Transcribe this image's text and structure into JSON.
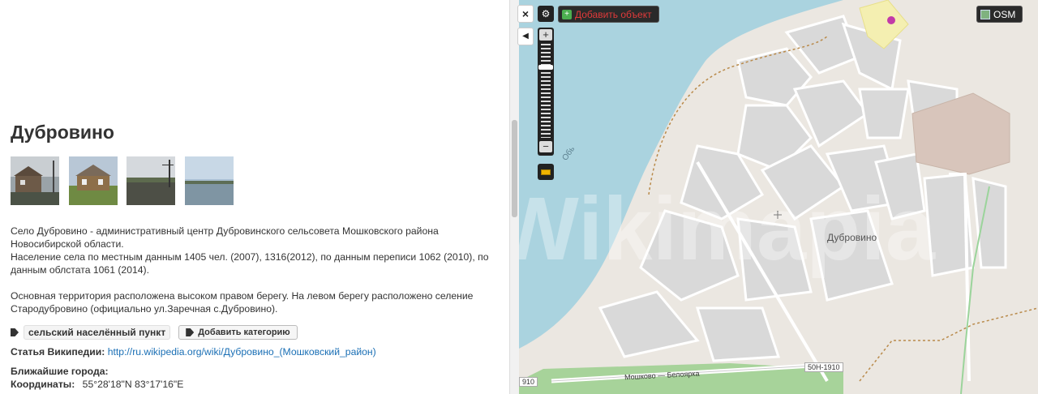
{
  "place": {
    "title": "Дубровино",
    "description": [
      "Село Дубровино - административный центр Дубровинского сельсовета Мошковского района Новосибирской области.",
      "Население села по местным данным 1405 чел. (2007), 1316(2012), по данным переписи 1062 (2010), по данным облстата 1061 (2014).",
      "",
      "Основная территория расположена высоком правом берегу. На левом берегу расположено селение Стародубровино (официально ул.Заречная с.Дубровино)."
    ],
    "tag_label": "сельский населённый пункт",
    "add_category_label": "Добавить категорию",
    "wiki_label": "Статья Википедии:",
    "wiki_url": "http://ru.wikipedia.org/wiki/Дубровино_(Мошковский_район)",
    "nearest_label": "Ближайшие города:",
    "coords_label": "Координаты:",
    "coords_value": "55°28'18\"N 83°17'16\"E"
  },
  "map": {
    "close_label": "×",
    "add_object_label": "Добавить объект",
    "osm_label": "OSM",
    "zoom_in": "+",
    "zoom_out": "−",
    "village_label": "Дубровино",
    "river_label": "Обь",
    "road_label": "Мошково — Белоярка",
    "road_ref": "50Н-1910",
    "road_ref_partial": "910",
    "watermark": "Wikimapia",
    "colors": {
      "water": "#aad3df",
      "land": "#ebe7e1",
      "blocks": "#d9d9d9",
      "forest": "#a7d39a",
      "accent_red": "#e03a3a"
    }
  }
}
